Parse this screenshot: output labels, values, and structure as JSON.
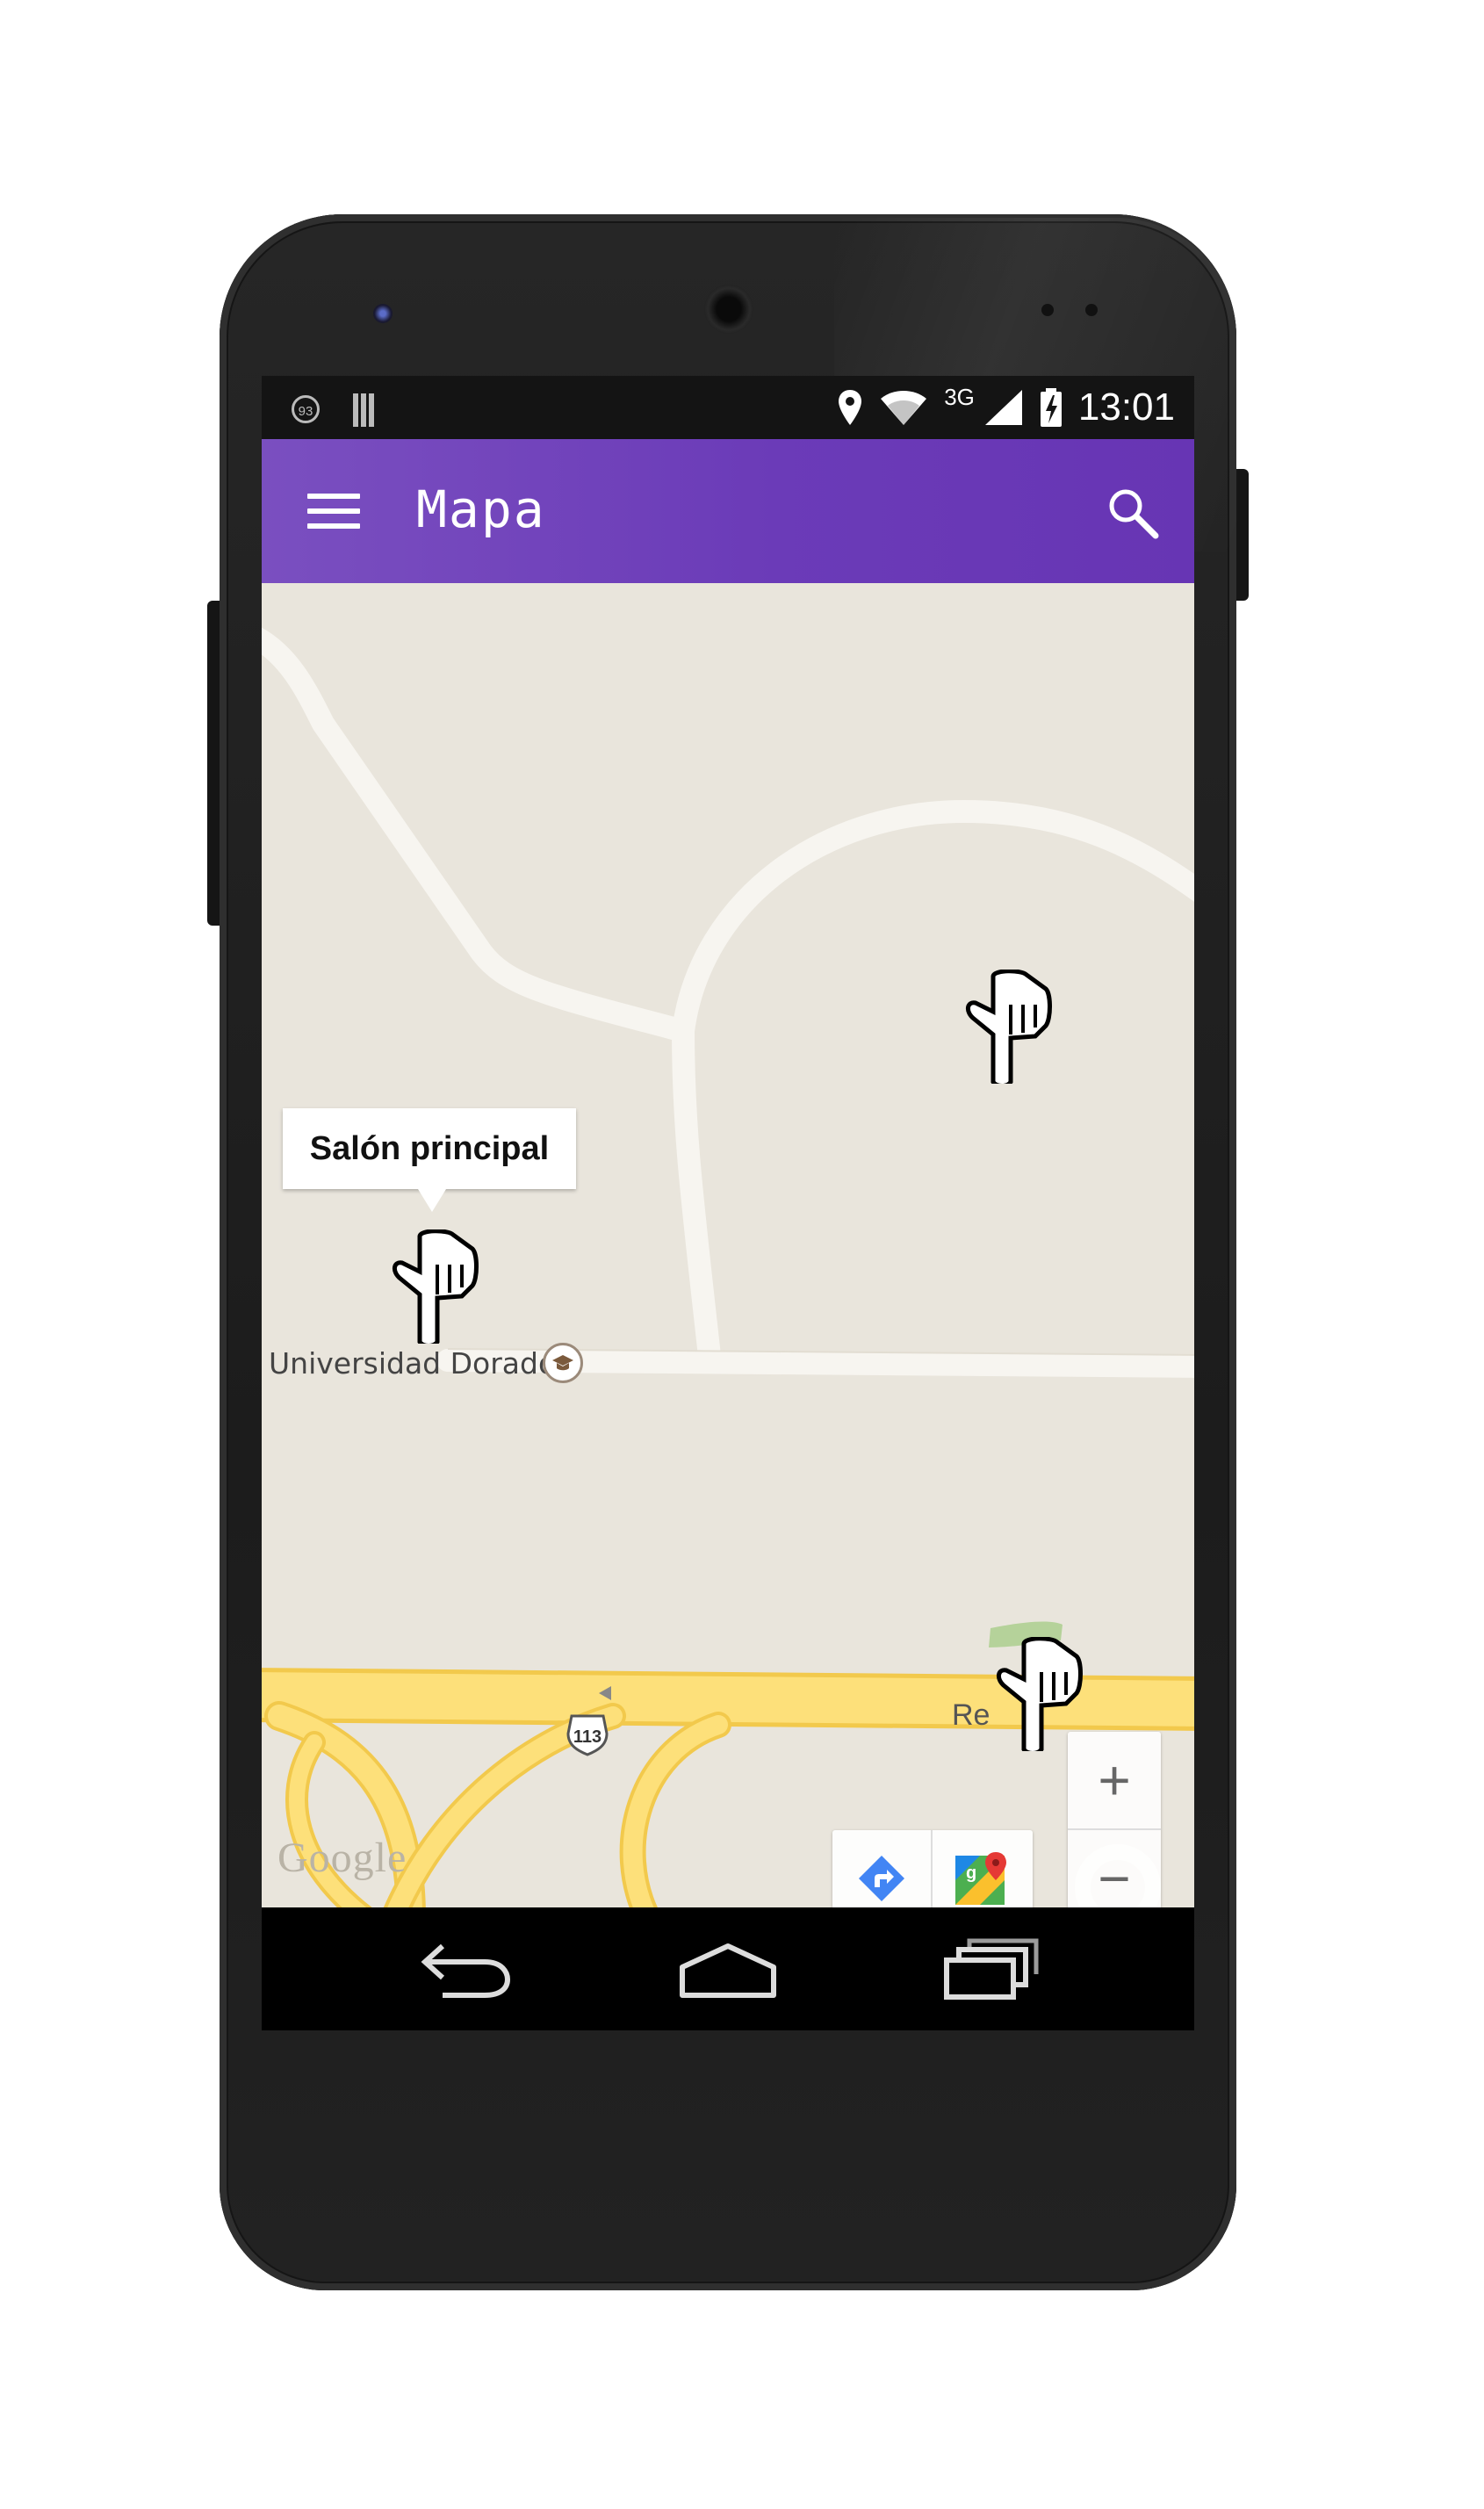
{
  "status_bar": {
    "notification_badge": "93",
    "network": "3G",
    "time": "13:01",
    "icons": [
      "location-icon",
      "wifi-icon",
      "signal-icon",
      "battery-charging-icon"
    ]
  },
  "app_bar": {
    "title": "Mapa",
    "menu_icon": "hamburger-menu-icon",
    "search_icon": "search-icon"
  },
  "map": {
    "info_window_title": "Salón principal",
    "poi_label": "Universidad Dorados",
    "poi_icon": "graduation-cap-icon",
    "highway_shield": "113",
    "road_label_partial": "Re",
    "attribution": "Google",
    "markers": [
      "pointing-hand-marker",
      "pointing-hand-marker",
      "pointing-hand-marker"
    ],
    "zoom_in_label": "+",
    "zoom_out_label": "−",
    "toolbar": [
      "directions-icon",
      "google-maps-icon"
    ]
  },
  "nav_bar": {
    "buttons": [
      "back-icon",
      "home-icon",
      "recents-icon"
    ]
  },
  "colors": {
    "app_bar": "#6b3bb8",
    "map_land": "#e9e5dc",
    "road_minor": "#f7f5f0",
    "highway": "#fde07a",
    "highway_casing": "#f2c94c"
  }
}
